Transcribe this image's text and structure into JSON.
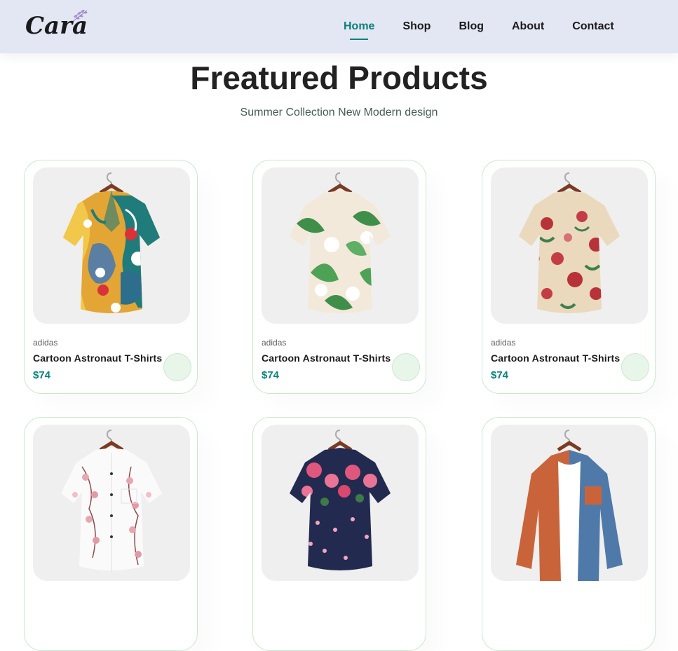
{
  "brand": {
    "logo_text": "Cara"
  },
  "nav": {
    "items": [
      {
        "label": "Home",
        "active": true
      },
      {
        "label": "Shop",
        "active": false
      },
      {
        "label": "Blog",
        "active": false
      },
      {
        "label": "About",
        "active": false
      },
      {
        "label": "Contact",
        "active": false
      }
    ]
  },
  "section": {
    "title": "Freatured Products",
    "subtitle": "Summer Collection New Modern design"
  },
  "products": [
    {
      "brand": "adidas",
      "title": "Cartoon Astronaut T-Shirts",
      "price": "$74",
      "shirt": "colorful-abstract-print"
    },
    {
      "brand": "adidas",
      "title": "Cartoon Astronaut T-Shirts",
      "price": "$74",
      "shirt": "green-leaf-floral"
    },
    {
      "brand": "adidas",
      "title": "Cartoon Astronaut T-Shirts",
      "price": "$74",
      "shirt": "red-rose-floral"
    },
    {
      "brand": "",
      "title": "",
      "price": "",
      "shirt": "white-pink-blossom"
    },
    {
      "brand": "",
      "title": "",
      "price": "",
      "shirt": "navy-pink-floral"
    },
    {
      "brand": "",
      "title": "",
      "price": "",
      "shirt": "orange-blue-colorblock"
    }
  ],
  "colors": {
    "accent": "#088178",
    "header_bg": "#e3e6f3",
    "card_border": "#cce7d0",
    "cart_button_bg": "#e8f6ea"
  }
}
